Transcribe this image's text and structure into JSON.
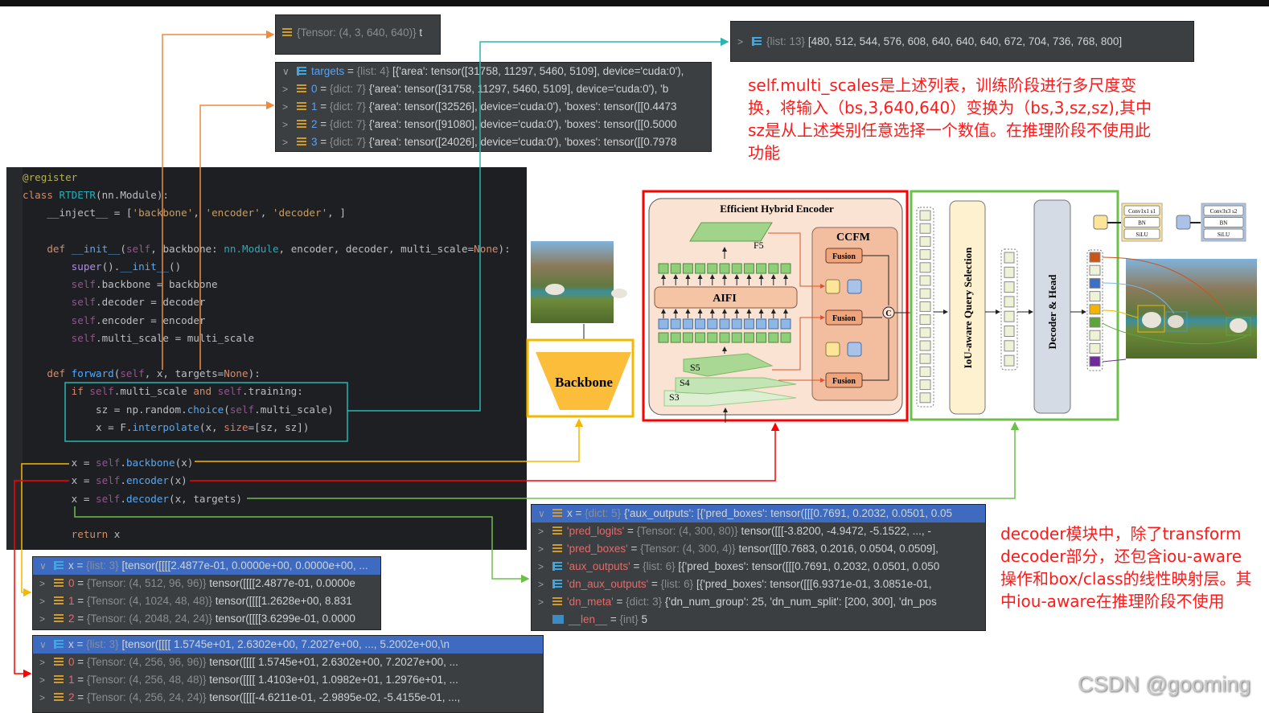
{
  "input_tensor": {
    "type": "{Tensor: (4, 3, 640, 640)}",
    "value": "t"
  },
  "multi_scale_list": {
    "type": "{list: 13}",
    "value": "[480, 512, 544, 576, 608, 640, 640, 640, 672, 704, 736, 768, 800]"
  },
  "targets_panel": {
    "rows": [
      {
        "chev": "∨",
        "icon": "list",
        "name": "targets",
        "cls": "nm-blue",
        "type": "{list: 4}",
        "value": "[{'area': tensor([31758, 11297,  5460,  5109], device='cuda:0'),"
      },
      {
        "chev": ">",
        "icon": "dict",
        "name": "0",
        "cls": "nm-blue",
        "type": "{dict: 7}",
        "value": "{'area': tensor([31758, 11297,  5460,  5109], device='cuda:0'), 'b"
      },
      {
        "chev": ">",
        "icon": "dict",
        "name": "1",
        "cls": "nm-blue",
        "type": "{dict: 7}",
        "value": "{'area': tensor([32526], device='cuda:0'), 'boxes': tensor([[0.4473"
      },
      {
        "chev": ">",
        "icon": "dict",
        "name": "2",
        "cls": "nm-blue",
        "type": "{dict: 7}",
        "value": "{'area': tensor([91080], device='cuda:0'), 'boxes': tensor([[0.5000"
      },
      {
        "chev": ">",
        "icon": "dict",
        "name": "3",
        "cls": "nm-blue",
        "type": "{dict: 7}",
        "value": "{'area': tensor([24026], device='cuda:0'), 'boxes': tensor([[0.7978"
      }
    ]
  },
  "backbone_panel": {
    "rows": [
      {
        "chev": "∨",
        "icon": "list",
        "name": "x",
        "cls": "",
        "type": "{list: 3}",
        "value": "[tensor([[[[2.4877e-01, 0.0000e+00, 0.0000e+00,  ...",
        "sel": true
      },
      {
        "chev": ">",
        "icon": "dict",
        "name": "0",
        "cls": "nm-red",
        "type": "{Tensor: (4, 512, 96, 96)}",
        "value": "tensor([[[[2.4877e-01, 0.0000e"
      },
      {
        "chev": ">",
        "icon": "dict",
        "name": "1",
        "cls": "nm-red",
        "type": "{Tensor: (4, 1024, 48, 48)}",
        "value": "tensor([[[[1.2628e+00, 8.831"
      },
      {
        "chev": ">",
        "icon": "dict",
        "name": "2",
        "cls": "nm-red",
        "type": "{Tensor: (4, 2048, 24, 24)}",
        "value": "tensor([[[[3.6299e-01, 0.0000"
      }
    ]
  },
  "encoder_panel": {
    "rows": [
      {
        "chev": "∨",
        "icon": "list",
        "name": "x",
        "cls": "",
        "type": "{list: 3}",
        "value": "[tensor([[[[ 1.5745e+01,  2.6302e+00,  7.2027e+00,  ...,  5.2002e+00,\\n",
        "sel": true
      },
      {
        "chev": ">",
        "icon": "dict",
        "name": "0",
        "cls": "nm-red",
        "type": "{Tensor: (4, 256, 96, 96)}",
        "value": "tensor([[[[ 1.5745e+01,  2.6302e+00,  7.2027e+00,  ..."
      },
      {
        "chev": ">",
        "icon": "dict",
        "name": "1",
        "cls": "nm-red",
        "type": "{Tensor: (4, 256, 48, 48)}",
        "value": "tensor([[[[ 1.4103e+01,  1.0982e+01,  1.2976e+01,  ..."
      },
      {
        "chev": ">",
        "icon": "dict",
        "name": "2",
        "cls": "nm-red",
        "type": "{Tensor: (4, 256, 24, 24)}",
        "value": "tensor([[[[-4.6211e-01, -2.9895e-02, -5.4155e-01,  ...,"
      }
    ]
  },
  "decoder_panel": {
    "rows": [
      {
        "chev": "∨",
        "icon": "dict",
        "name": "x",
        "cls": "",
        "type": "{dict: 5}",
        "value": "{'aux_outputs': [{'pred_boxes': tensor([[[0.7691, 0.2032, 0.0501, 0.05",
        "sel": true
      },
      {
        "chev": ">",
        "icon": "dict",
        "name": "'pred_logits'",
        "cls": "nm-key",
        "type": "{Tensor: (4, 300, 80)}",
        "value": "tensor([[[-3.8200, -4.9472, -5.1522,  ..., -"
      },
      {
        "chev": ">",
        "icon": "dict",
        "name": "'pred_boxes'",
        "cls": "nm-key",
        "type": "{Tensor: (4, 300, 4)}",
        "value": "tensor([[[0.7683, 0.2016, 0.0504, 0.0509],"
      },
      {
        "chev": ">",
        "icon": "list",
        "name": "'aux_outputs'",
        "cls": "nm-key",
        "type": "{list: 6}",
        "value": "[{'pred_boxes': tensor([[[0.7691, 0.2032, 0.0501, 0.050"
      },
      {
        "chev": ">",
        "icon": "list",
        "name": "'dn_aux_outputs'",
        "cls": "nm-key",
        "type": "{list: 6}",
        "value": "[{'pred_boxes': tensor([[[6.9371e-01, 3.0851e-01,"
      },
      {
        "chev": ">",
        "icon": "dict",
        "name": "'dn_meta'",
        "cls": "nm-key",
        "type": "{dict: 3}",
        "value": "{'dn_num_group': 25, 'dn_num_split': [200, 300], 'dn_pos"
      },
      {
        "chev": " ",
        "icon": "int",
        "name": "__len__",
        "cls": "nm-key",
        "type": "{int}",
        "value": "5"
      }
    ]
  },
  "code": [
    [
      [
        "@register",
        "dec"
      ]
    ],
    [
      [
        "class ",
        "k"
      ],
      [
        "RTDETR",
        "cls"
      ],
      [
        "(nn.Module):",
        ""
      ]
    ],
    [
      [
        "    __inject__ = [",
        "",
        ""
      ],
      [
        "'backbone'",
        "strq"
      ],
      [
        ", ",
        ""
      ],
      [
        "'encoder'",
        "strq"
      ],
      [
        ", ",
        ""
      ],
      [
        "'decoder'",
        "strq"
      ],
      [
        ", ]",
        ""
      ]
    ],
    [],
    [
      [
        "    def ",
        "k"
      ],
      [
        "__init__",
        "fn"
      ],
      [
        "(",
        ""
      ],
      [
        "self",
        "self"
      ],
      [
        ", backbone: ",
        ""
      ],
      [
        "nn.Module",
        "cls"
      ],
      [
        ", encoder, decoder, multi_scale=",
        ""
      ],
      [
        "None",
        "k"
      ],
      [
        "):",
        ""
      ]
    ],
    [
      [
        "        super",
        "purp"
      ],
      [
        "().",
        ""
      ],
      [
        "__init__",
        "fn"
      ],
      [
        "()",
        ""
      ]
    ],
    [
      [
        "        self",
        "self"
      ],
      [
        ".backbone = backbone",
        ""
      ]
    ],
    [
      [
        "        self",
        "self"
      ],
      [
        ".decoder = decoder",
        ""
      ]
    ],
    [
      [
        "        self",
        "self"
      ],
      [
        ".encoder = encoder",
        ""
      ]
    ],
    [
      [
        "        self",
        "self"
      ],
      [
        ".multi_scale = multi_scale",
        ""
      ]
    ],
    [],
    [
      [
        "    def ",
        "k"
      ],
      [
        "forward",
        "fn"
      ],
      [
        "(",
        ""
      ],
      [
        "self",
        "self"
      ],
      [
        ", x, targets=",
        ""
      ],
      [
        "None",
        "k"
      ],
      [
        "):",
        ""
      ]
    ],
    [
      [
        "        if ",
        "k"
      ],
      [
        "self",
        "self"
      ],
      [
        ".multi_scale ",
        ""
      ],
      [
        "and ",
        "k"
      ],
      [
        "self",
        "self"
      ],
      [
        ".training:",
        ""
      ]
    ],
    [
      [
        "            sz = np.random.",
        ""
      ],
      [
        "choice",
        "fn"
      ],
      [
        "(",
        ""
      ],
      [
        "self",
        "self"
      ],
      [
        ".multi_scale)",
        ""
      ]
    ],
    [
      [
        "            x = F.",
        ""
      ],
      [
        "interpolate",
        "fn"
      ],
      [
        "(x, ",
        ""
      ],
      [
        "size",
        "prm"
      ],
      [
        "=[sz, sz])",
        ""
      ]
    ],
    [],
    [
      [
        "        x = ",
        ""
      ],
      [
        "self",
        "self"
      ],
      [
        ".",
        ""
      ],
      [
        "backbone",
        "fn"
      ],
      [
        "(x)",
        ""
      ]
    ],
    [
      [
        "        x = ",
        ""
      ],
      [
        "self",
        "self"
      ],
      [
        ".",
        ""
      ],
      [
        "encoder",
        "fn"
      ],
      [
        "(x)",
        ""
      ]
    ],
    [
      [
        "        x = ",
        ""
      ],
      [
        "self",
        "self"
      ],
      [
        ".",
        ""
      ],
      [
        "decoder",
        "fn"
      ],
      [
        "(x, targets)",
        ""
      ]
    ],
    [],
    [
      [
        "        return ",
        "k"
      ],
      [
        "x",
        ""
      ]
    ]
  ],
  "notes": {
    "multi_scale": "self.multi_scales是上述列表，训练阶段进行多尺度变换，将输入（bs,3,640,640）变换为（bs,3,sz,sz),其中sz是从上述类别任意选择一个数值。在推理阶段不使用此功能",
    "decoder": "decoder模块中，除了transform decoder部分，还包含iou-aware操作和box/class的线性映射层。其中iou-aware在推理阶段不使用"
  },
  "diagram": {
    "backbone": "Backbone",
    "encoder_title": "Efficient Hybrid Encoder",
    "ccfm": "CCFM",
    "aifi": "AIFI",
    "fusion": "Fusion",
    "concat": "C",
    "f5": "F5",
    "s5": "S5",
    "s4": "S4",
    "s3": "S3",
    "query_selection": "IoU-aware Query Selection",
    "decoder_head": "Decoder & Head",
    "legend_yellow": [
      "Conv1x1 s1",
      "BN",
      "SiLU"
    ],
    "legend_blue": [
      "Conv3x3 s2",
      "BN",
      "SiLU"
    ],
    "output_colors": [
      "#c8561a",
      "#eef2d6",
      "#3d6fc4",
      "#eef2d6",
      "#f2b400",
      "#5ea43c",
      "#eef2d6",
      "#eef2d6",
      "#6d2c9a"
    ]
  },
  "colors": {
    "backbone": "#f5b800",
    "encoder": "#ff0000",
    "decoder": "#6cc04a",
    "multi_scale": "#2bb5b0",
    "inputs": "#f08a3c"
  },
  "watermark": "CSDN @gooming"
}
